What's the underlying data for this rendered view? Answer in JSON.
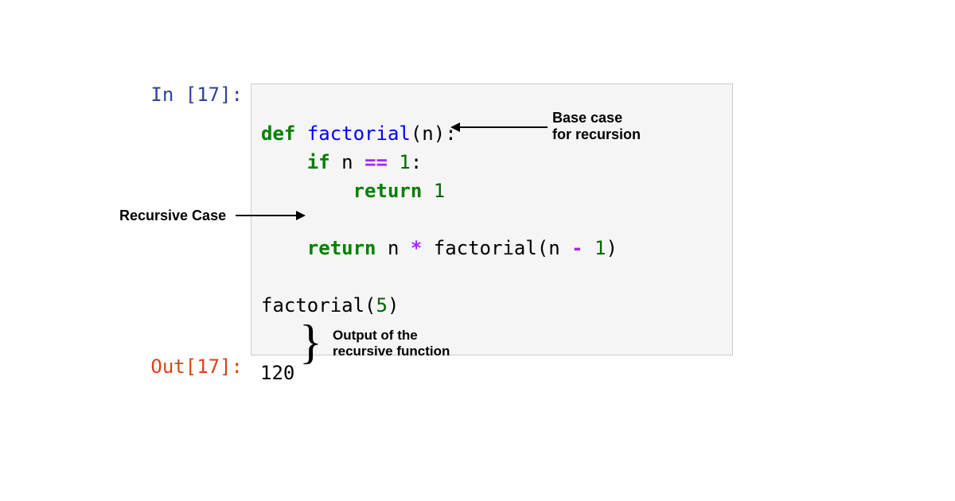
{
  "prompts": {
    "in": "In [17]:",
    "out": "Out[17]:"
  },
  "code": {
    "l1_def": "def",
    "l1_name": "factorial",
    "l1_open": "(n):",
    "l2_if": "if",
    "l2_var": " n ",
    "l2_eq": "==",
    "l2_one": " 1",
    "l2_colon": ":",
    "l3_return": "return",
    "l3_one": " 1",
    "l5_return": "return",
    "l5_expr1": " n ",
    "l5_mul": "*",
    "l5_expr2": " factorial(n ",
    "l5_minus": "-",
    "l5_expr3": " 1",
    "l5_close": ")",
    "l7_call": "factorial(",
    "l7_arg": "5",
    "l7_close": ")"
  },
  "output_value": "120",
  "annotations": {
    "base_case_l1": "Base case",
    "base_case_l2": "for recursion",
    "recursive_case": "Recursive Case",
    "output_l1": "Output of the",
    "output_l2": "recursive function"
  }
}
